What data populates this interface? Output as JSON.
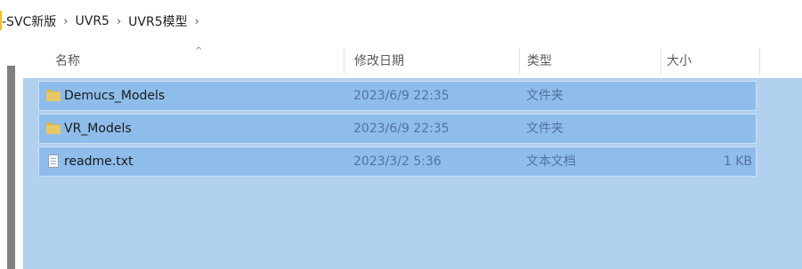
{
  "breadcrumb": {
    "items": [
      "-SVC新版",
      "UVR5",
      "UVR5模型"
    ],
    "separator": "›"
  },
  "columns": {
    "name": "名称",
    "date": "修改日期",
    "type": "类型",
    "size": "大小"
  },
  "sort": {
    "column": "name",
    "direction": "ascending",
    "icon": "caret-up"
  },
  "files": [
    {
      "name": "Demucs_Models",
      "date": "2023/6/9 22:35",
      "type": "文件夹",
      "size": "",
      "icon": "folder-icon"
    },
    {
      "name": "VR_Models",
      "date": "2023/6/9 22:35",
      "type": "文件夹",
      "size": "",
      "icon": "folder-icon"
    },
    {
      "name": "readme.txt",
      "date": "2023/3/2 5:36",
      "type": "文本文档",
      "size": "1 KB",
      "icon": "text-file-icon"
    }
  ],
  "colors": {
    "selection_bg": "#8ebdec",
    "pane_bg": "#b2d1ef",
    "meta_text": "#54739b"
  }
}
